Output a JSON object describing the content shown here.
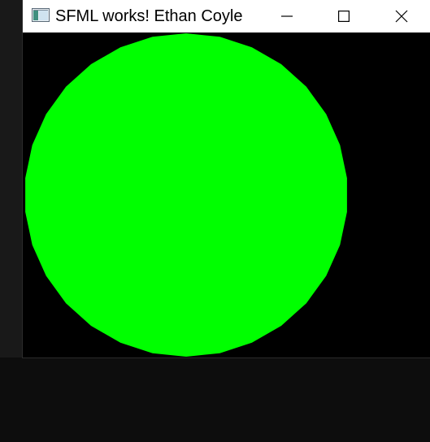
{
  "window": {
    "title": "SFML works! Ethan Coyle",
    "controls": {
      "minimize": "minimize-icon",
      "maximize": "maximize-icon",
      "close": "close-icon"
    }
  },
  "scene": {
    "background_color": "#000000",
    "shape": "circle",
    "shape_color": "#00ff00"
  },
  "colors": {
    "titlebar": "#ffffff",
    "desktop": "#0d0d0d"
  }
}
